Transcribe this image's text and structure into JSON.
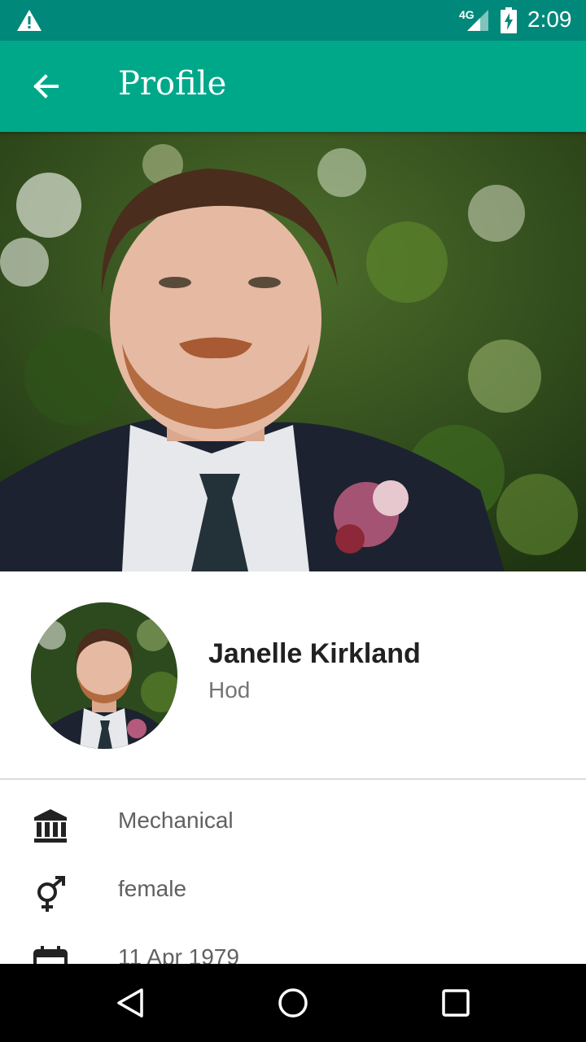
{
  "status_bar": {
    "network_label": "4G",
    "time": "2:09",
    "icons": [
      "warning-icon",
      "signal-icon",
      "battery-charging-icon"
    ]
  },
  "app_bar": {
    "title": "Profile",
    "back_icon": "arrow-back-icon"
  },
  "profile": {
    "name": "Janelle Kirkland",
    "role": "Hod"
  },
  "details": [
    {
      "icon": "bank-icon",
      "value": "Mechanical"
    },
    {
      "icon": "gender-icon",
      "value": "female"
    },
    {
      "icon": "calendar-icon",
      "value": "11 Apr 1979"
    }
  ],
  "nav_bar": {
    "icons": [
      "back-triangle-icon",
      "home-circle-icon",
      "recents-square-icon"
    ]
  },
  "colors": {
    "status_bar": "#00897b",
    "app_bar": "#00a88a",
    "nav_bar": "#000000"
  }
}
